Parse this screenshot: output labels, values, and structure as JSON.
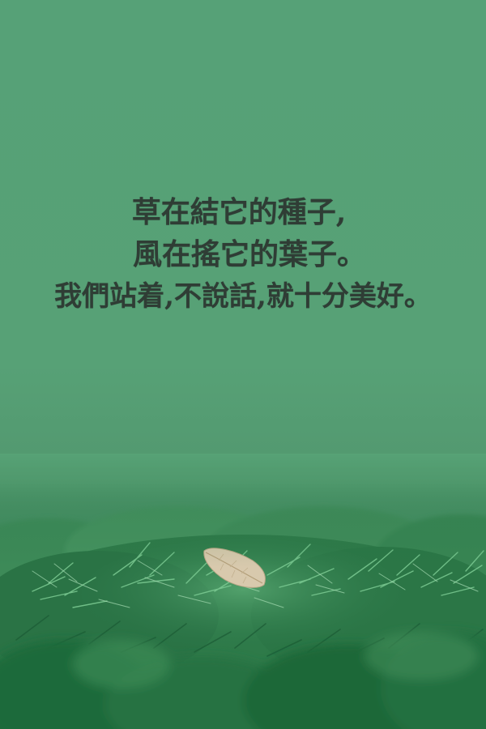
{
  "poem": {
    "line1": "草在結它的種子,",
    "line2": "風在搖它的葉子。",
    "line3": "我們站着,不說話,就十分美好。"
  },
  "colors": {
    "sky": "#57a276",
    "text": "#2f3d35",
    "foliage_dark": "#1f6a3e",
    "foliage_light": "#6bbf86",
    "leaf": "#d8c9ad"
  }
}
